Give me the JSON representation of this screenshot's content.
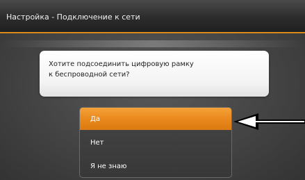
{
  "header": {
    "title": "Настройка - Подключение к сети"
  },
  "dialog": {
    "question_line1": "Хотите подсоединить цифровую рамку",
    "question_line2": "к беспроводной сети?"
  },
  "options": [
    {
      "label": "Да",
      "selected": true
    },
    {
      "label": "Нет",
      "selected": false
    },
    {
      "label": "Я не знаю",
      "selected": false
    }
  ],
  "colors": {
    "accent": "#e8871a",
    "title_underline": "#d98a1a",
    "background": "#3a3a3a"
  },
  "icons": {
    "pointer": "left-arrow-icon"
  }
}
